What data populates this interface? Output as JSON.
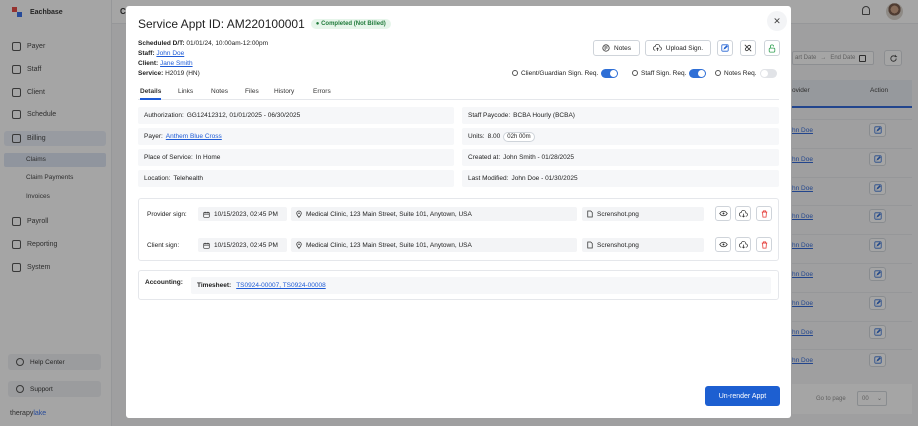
{
  "app": {
    "brand": "Eachbase",
    "page_title": "Cl",
    "footer_brand_a": "therapy",
    "footer_brand_b": "lake",
    "colors": {
      "accent": "#1d5fd1",
      "brand_red": "#e53935",
      "success": "#1f7a3a"
    }
  },
  "sidebar": {
    "items": [
      {
        "label": "Payer",
        "icon": "shield-icon"
      },
      {
        "label": "Staff",
        "icon": "users-icon"
      },
      {
        "label": "Client",
        "icon": "user-icon"
      },
      {
        "label": "Schedule",
        "icon": "calendar-icon"
      },
      {
        "label": "Billing",
        "icon": "billing-icon"
      },
      {
        "label": "Payroll",
        "icon": "payroll-icon"
      },
      {
        "label": "Reporting",
        "icon": "report-icon"
      },
      {
        "label": "System",
        "icon": "settings-icon"
      }
    ],
    "billing_sub": [
      "Claims",
      "Claim Payments",
      "Invoices"
    ],
    "help": "Help Center",
    "support": "Support"
  },
  "background": {
    "date_start_placeholder": "art Date",
    "date_end_placeholder": "End Date",
    "col_provider": "ovider",
    "col_action": "Action",
    "row_provider": "hn Doe",
    "pager_label": "Go to page",
    "pager_value": "00"
  },
  "modal": {
    "title": "Service Appt ID: AM220100001",
    "status": "Completed (Not Billed)",
    "scheduled_label": "Scheduled D/T:",
    "scheduled_value": "01/01/24, 10:00am-12:00pm",
    "staff_label": "Staff:",
    "staff_value": "John Doe",
    "client_label": "Client:",
    "client_value": "Jane Smith",
    "service_label": "Service:",
    "service_value": "H2019 (HN)",
    "notes_btn": "Notes",
    "upload_btn": "Upload Sign.",
    "toggles": [
      {
        "label": "Client/Guardian Sign. Req.",
        "on": true
      },
      {
        "label": "Staff Sign. Req.",
        "on": true
      },
      {
        "label": "Notes Req.",
        "on": false
      }
    ],
    "tabs": [
      "Details",
      "Links",
      "Notes",
      "Files",
      "History",
      "Errors"
    ],
    "active_tab": "Details",
    "details": {
      "authorization_label": "Authorization:",
      "authorization_value": "GG12412312, 01/01/2025 - 06/30/2025",
      "paycode_label": "Staff Paycode:",
      "paycode_value": "BCBA Hourly (BCBA)",
      "payer_label": "Payer:",
      "payer_value": "Anthem Blue Cross",
      "units_label": "Units:",
      "units_value": "8.00",
      "units_duration": "02h 00m",
      "pos_label": "Place of Service:",
      "pos_value": "In Home",
      "created_label": "Created at:",
      "created_value": "John Smith - 01/28/2025",
      "location_label": "Location:",
      "location_value": "Telehealth",
      "modified_label": "Last Modified:",
      "modified_value": "John Doe - 01/30/2025"
    },
    "signatures": [
      {
        "label": "Provider sign:",
        "date": "10/15/2023, 02:45 PM",
        "address": "Medical Clinic, 123 Main Street, Suite 101, Anytown, USA",
        "file": "Screnshot.png"
      },
      {
        "label": "Client sign:",
        "date": "10/15/2023, 02:45 PM",
        "address": "Medical Clinic, 123 Main Street, Suite 101, Anytown, USA",
        "file": "Screnshot.png"
      }
    ],
    "accounting_label": "Accounting:",
    "timesheet_label": "Timesheet:",
    "timesheet_value": "TS0924-00007, TS0924-00008",
    "unrender_btn": "Un-render Appt"
  }
}
